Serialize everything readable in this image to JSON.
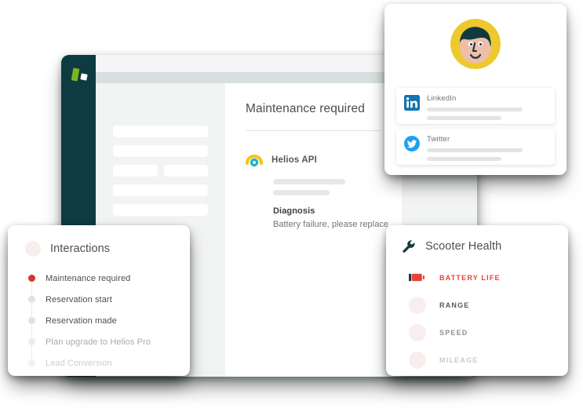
{
  "colors": {
    "sidebar": "#0e3b42",
    "logo_green": "#7ab51d",
    "accent_red": "#e8413c",
    "avatar_yellow": "#edc92e",
    "avatar_skin": "#f0bda8",
    "avatar_hair": "#12393f",
    "linkedin_blue": "#1275b1",
    "twitter_blue": "#1da1f2",
    "helios_yellow": "#f5c518",
    "helios_teal": "#1bb5c4",
    "placeholder_grey": "#e6e7e8",
    "wrench_navy": "#123a41"
  },
  "app_window": {
    "logo_name": "helios-logo",
    "panel": {
      "title": "Maintenance required",
      "device": {
        "icon_name": "helios-api-icon",
        "name": "Helios API",
        "diagnosis_label": "Diagnosis",
        "diagnosis_text": "Battery failure, please replace"
      }
    },
    "placeholder_rows": [
      {
        "type": "full"
      },
      {
        "type": "full"
      },
      {
        "type": "split"
      },
      {
        "type": "full"
      },
      {
        "type": "full"
      }
    ]
  },
  "contact_card": {
    "avatar_name": "user-avatar",
    "socials": [
      {
        "name": "LinkedIn",
        "icon_name": "linkedin-icon"
      },
      {
        "name": "Twitter",
        "icon_name": "twitter-icon"
      }
    ]
  },
  "interactions_card": {
    "title": "Interactions",
    "avatar_name": "contact-avatar-placeholder",
    "items": [
      {
        "label": "Maintenance required",
        "dot": "#d8342c",
        "color": "#4a4e51",
        "opacity": 1
      },
      {
        "label": "Reservation start",
        "dot": "#e2e2e2",
        "color": "#4a4e51",
        "opacity": 1
      },
      {
        "label": "Reservation made",
        "dot": "#e2e2e2",
        "color": "#4a4e51",
        "opacity": 1
      },
      {
        "label": "Plan upgrade to Helios Pro",
        "dot": "#ececec",
        "color": "#a8abad",
        "opacity": 1
      },
      {
        "label": "Lead Conversion",
        "dot": "#f1f1f1",
        "color": "#cbcdcf",
        "opacity": 1
      }
    ]
  },
  "health_card": {
    "title": "Scooter Health",
    "icon_name": "wrench-icon",
    "metrics": [
      {
        "label": "BATTERY LIFE",
        "icon": "battery-icon",
        "color": "#e8413c",
        "opacity": 1
      },
      {
        "label": "RANGE",
        "icon": "circle",
        "color": "#54585b",
        "opacity": 1
      },
      {
        "label": "SPEED",
        "icon": "circle",
        "color": "#8e9194",
        "opacity": 1
      },
      {
        "label": "MILEAGE",
        "icon": "circle",
        "color": "#c9cbcd",
        "opacity": 1
      }
    ]
  }
}
